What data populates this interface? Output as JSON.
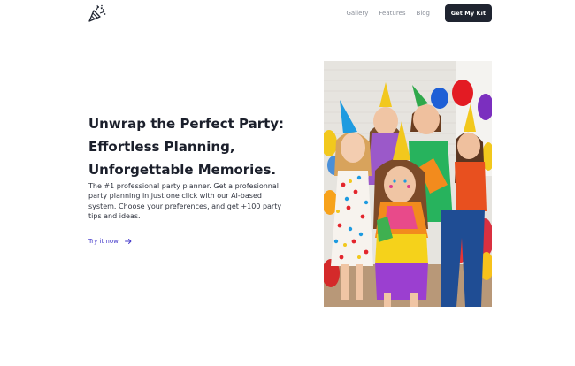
{
  "header": {
    "logo_icon": "party-popper-icon",
    "nav": [
      "Gallery",
      "Features",
      "Blog"
    ],
    "cta_label": "Get My Kit"
  },
  "hero": {
    "title": "Unwrap the Perfect Party: Effortless Planning, Unforgettable Memories.",
    "description": "The #1 professional party planner. Get a profesionnal party planning in just one click with our AI-based system. Choose your preferences, and get +100 party tips and ideas.",
    "link_label": "Try it now",
    "link_icon": "arrow-right-icon",
    "image_subject": "children in party hats with balloons"
  },
  "colors": {
    "text_dark": "#1b1f2b",
    "link": "#4338ca",
    "button_bg": "#1f2430",
    "nav_text": "#8a8f99"
  }
}
